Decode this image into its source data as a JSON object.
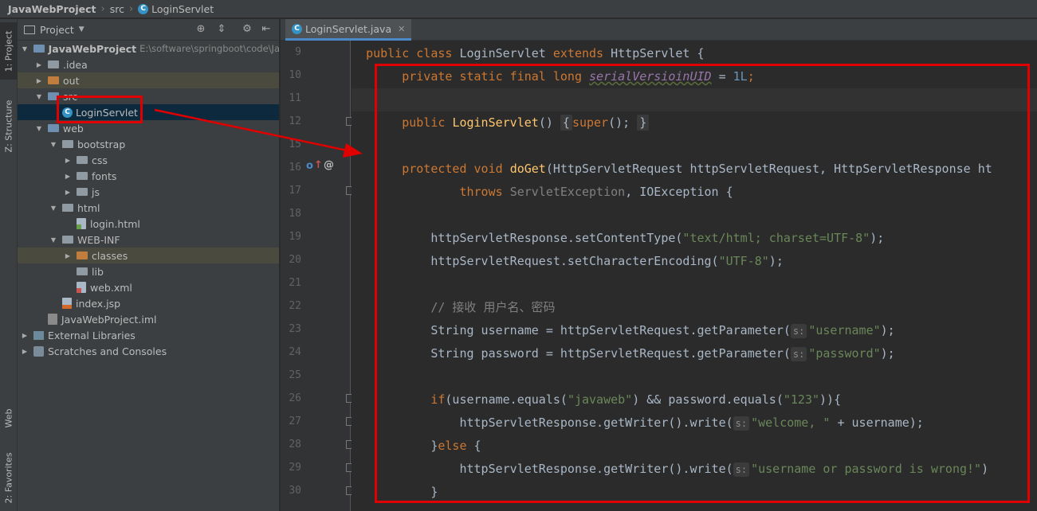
{
  "navbar": {
    "project": "JavaWebProject",
    "folder": "src",
    "file": "LoginServlet",
    "file_icon": "C"
  },
  "stripe": {
    "project_tab": "1: Project",
    "structure_tab": "Z: Structure",
    "web_tab": "Web",
    "favorites_tab": "2: Favorites"
  },
  "project_panel": {
    "title": "Project",
    "tree": [
      {
        "label": "JavaWebProject",
        "path": "E:\\software\\springboot\\code\\Ja",
        "depth": 0,
        "toggle": "open",
        "icon": "module"
      },
      {
        "label": ".idea",
        "depth": 1,
        "toggle": "closed",
        "icon": "folder"
      },
      {
        "label": "out",
        "depth": 1,
        "toggle": "closed",
        "icon": "folder-orange"
      },
      {
        "label": "src",
        "depth": 1,
        "toggle": "open",
        "icon": "folder-blue"
      },
      {
        "label": "LoginServlet",
        "depth": 2,
        "toggle": "none",
        "icon": "class"
      },
      {
        "label": "web",
        "depth": 1,
        "toggle": "open",
        "icon": "folder-blue"
      },
      {
        "label": "bootstrap",
        "depth": 2,
        "toggle": "open",
        "icon": "folder"
      },
      {
        "label": "css",
        "depth": 3,
        "toggle": "closed",
        "icon": "folder"
      },
      {
        "label": "fonts",
        "depth": 3,
        "toggle": "closed",
        "icon": "folder"
      },
      {
        "label": "js",
        "depth": 3,
        "toggle": "closed",
        "icon": "folder"
      },
      {
        "label": "html",
        "depth": 2,
        "toggle": "open",
        "icon": "folder"
      },
      {
        "label": "login.html",
        "depth": 3,
        "toggle": "none",
        "icon": "html"
      },
      {
        "label": "WEB-INF",
        "depth": 2,
        "toggle": "open",
        "icon": "folder"
      },
      {
        "label": "classes",
        "depth": 3,
        "toggle": "closed",
        "icon": "folder-orange"
      },
      {
        "label": "lib",
        "depth": 3,
        "toggle": "none",
        "icon": "folder"
      },
      {
        "label": "web.xml",
        "depth": 3,
        "toggle": "none",
        "icon": "xml"
      },
      {
        "label": "index.jsp",
        "depth": 2,
        "toggle": "none",
        "icon": "jsp"
      },
      {
        "label": "JavaWebProject.iml",
        "depth": 1,
        "toggle": "none",
        "icon": "iml"
      },
      {
        "label": "External Libraries",
        "depth": 0,
        "toggle": "closed",
        "icon": "lib"
      },
      {
        "label": "Scratches and Consoles",
        "depth": 0,
        "toggle": "closed",
        "icon": "scratch"
      }
    ]
  },
  "editor": {
    "tab_label": "LoginServlet.java",
    "line_numbers": [
      "9",
      "10",
      "11",
      "12",
      "15",
      "16",
      "17",
      "18",
      "19",
      "20",
      "21",
      "22",
      "23",
      "24",
      "25",
      "26",
      "27",
      "28",
      "29",
      "30"
    ],
    "code": {
      "l9_kw1": "public",
      "l9_kw2": "class",
      "l9_name": "LoginServlet",
      "l9_kw3": "extends",
      "l9_super": "HttpServlet {",
      "l10_kw": "private static final long",
      "l10_field": "serialVersioinUID",
      "l10_eq": " = ",
      "l10_num": "1L",
      "l10_semi": ";",
      "l12_kw": "public",
      "l12_fn": "LoginServlet",
      "l12_paren": "()",
      "l12_brace1": "{",
      "l12_super": "super",
      "l12_call": "();",
      "l12_brace2": "}",
      "l16_kw": "protected void",
      "l16_fn": "doGet",
      "l16_params": "(HttpServletRequest httpServletRequest, HttpServletResponse ht",
      "l17_kw": "throws",
      "l17_ex1": "ServletException",
      "l17_rest": ", IOException {",
      "l19_pre": "httpServletResponse.setContentType(",
      "l19_str": "\"text/html; charset=UTF-8\"",
      "l19_post": ");",
      "l20_pre": "httpServletRequest.setCharacterEncoding(",
      "l20_str": "\"UTF-8\"",
      "l20_post": ");",
      "l22_cmt": "// 接收 用户名、密码",
      "l23_pre": "String username = httpServletRequest.getParameter(",
      "l23_hint": "s:",
      "l23_str": "\"username\"",
      "l23_post": ");",
      "l24_pre": "String password = httpServletRequest.getParameter(",
      "l24_hint": "s:",
      "l24_str": "\"password\"",
      "l24_post": ");",
      "l26_kw": "if",
      "l26_a": "(username.equals(",
      "l26_s1": "\"javaweb\"",
      "l26_b": ") && password.equals(",
      "l26_s2": "\"123\"",
      "l26_c": ")){",
      "l27_pre": "httpServletResponse.getWriter().write(",
      "l27_hint": "s:",
      "l27_str": "\"welcome, \"",
      "l27_post": " + username);",
      "l28_brace": "}",
      "l28_kw": "else",
      "l28_rest": " {",
      "l29_pre": "httpServletResponse.getWriter().write(",
      "l29_hint": "s:",
      "l29_str": "\"username or password is wrong!\"",
      "l29_post": ")",
      "l30_brace": "}"
    }
  },
  "colors": {
    "annotation_red": "#e00000",
    "keyword": "#cc7832",
    "string": "#6a8759",
    "function": "#ffc66d",
    "number": "#6897bb"
  }
}
